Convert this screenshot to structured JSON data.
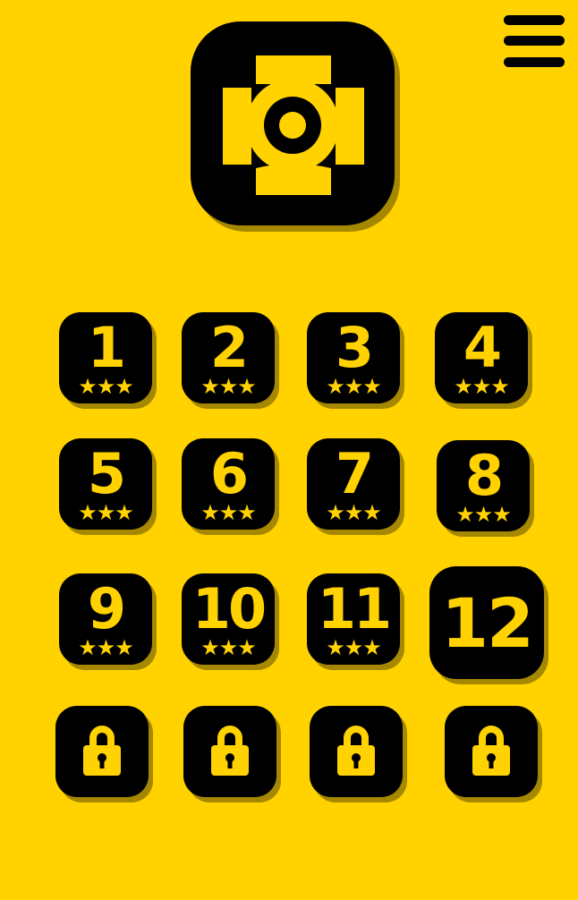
{
  "theme": {
    "background": "#FFD200",
    "tile": "#000000",
    "accent": "#FFD200"
  },
  "header": {
    "logo_icon": "target-cross-logo-icon",
    "menu_icon": "hamburger-menu-icon"
  },
  "levels": [
    {
      "number": "1",
      "stars": "★★★",
      "state": "completed"
    },
    {
      "number": "2",
      "stars": "★★★",
      "state": "completed"
    },
    {
      "number": "3",
      "stars": "★★★",
      "state": "completed"
    },
    {
      "number": "4",
      "stars": "★★★",
      "state": "completed"
    },
    {
      "number": "5",
      "stars": "★★★",
      "state": "completed"
    },
    {
      "number": "6",
      "stars": "★★★",
      "state": "completed"
    },
    {
      "number": "7",
      "stars": "★★★",
      "state": "completed"
    },
    {
      "number": "8",
      "stars": "★★★",
      "state": "completed"
    },
    {
      "number": "9",
      "stars": "★★★",
      "state": "completed"
    },
    {
      "number": "10",
      "stars": "★★★",
      "state": "completed"
    },
    {
      "number": "11",
      "stars": "★★★",
      "state": "completed"
    },
    {
      "number": "12",
      "stars": "",
      "state": "current"
    },
    {
      "number": "",
      "stars": "",
      "state": "locked",
      "icon": "padlock-icon"
    },
    {
      "number": "",
      "stars": "",
      "state": "locked",
      "icon": "padlock-icon"
    },
    {
      "number": "",
      "stars": "",
      "state": "locked",
      "icon": "padlock-icon"
    },
    {
      "number": "",
      "stars": "",
      "state": "locked",
      "icon": "padlock-icon"
    }
  ]
}
